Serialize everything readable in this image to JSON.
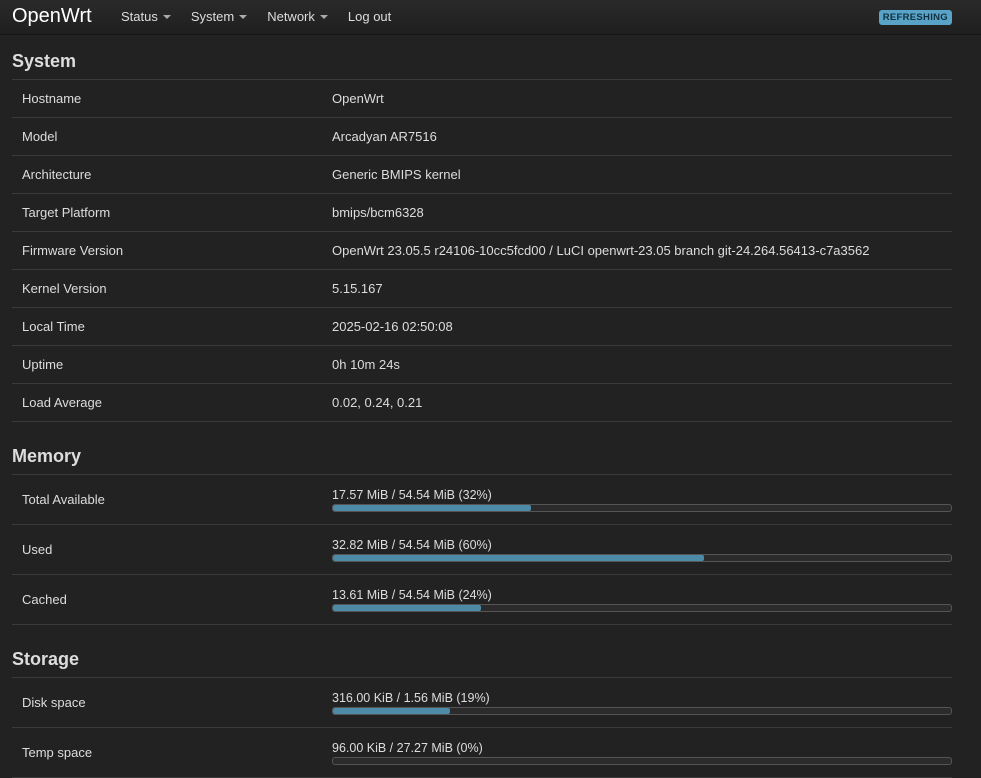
{
  "app": {
    "brand": "OpenWrt",
    "status_badge": "REFRESHING"
  },
  "nav": [
    {
      "label": "Status",
      "dropdown": true
    },
    {
      "label": "System",
      "dropdown": true
    },
    {
      "label": "Network",
      "dropdown": true
    },
    {
      "label": "Log out",
      "dropdown": false
    }
  ],
  "system": {
    "title": "System",
    "rows": [
      {
        "label": "Hostname",
        "value": "OpenWrt"
      },
      {
        "label": "Model",
        "value": "Arcadyan AR7516"
      },
      {
        "label": "Architecture",
        "value": "Generic BMIPS kernel"
      },
      {
        "label": "Target Platform",
        "value": "bmips/bcm6328"
      },
      {
        "label": "Firmware Version",
        "value": "OpenWrt 23.05.5 r24106-10cc5fcd00 / LuCI openwrt-23.05 branch git-24.264.56413-c7a3562"
      },
      {
        "label": "Kernel Version",
        "value": "5.15.167"
      },
      {
        "label": "Local Time",
        "value": "2025-02-16 02:50:08"
      },
      {
        "label": "Uptime",
        "value": "0h 10m 24s"
      },
      {
        "label": "Load Average",
        "value": "0.02, 0.24, 0.21"
      }
    ]
  },
  "memory": {
    "title": "Memory",
    "rows": [
      {
        "label": "Total Available",
        "text": "17.57 MiB / 54.54 MiB (32%)",
        "percent": 32
      },
      {
        "label": "Used",
        "text": "32.82 MiB / 54.54 MiB (60%)",
        "percent": 60
      },
      {
        "label": "Cached",
        "text": "13.61 MiB / 54.54 MiB (24%)",
        "percent": 24
      }
    ]
  },
  "storage": {
    "title": "Storage",
    "rows": [
      {
        "label": "Disk space",
        "text": "316.00 KiB / 1.56 MiB (19%)",
        "percent": 19
      },
      {
        "label": "Temp space",
        "text": "96.00 KiB / 27.27 MiB (0%)",
        "percent": 0
      }
    ]
  },
  "colors": {
    "accent": "#4c8aa8",
    "background": "#222222",
    "badge": "#5aa3c8"
  }
}
